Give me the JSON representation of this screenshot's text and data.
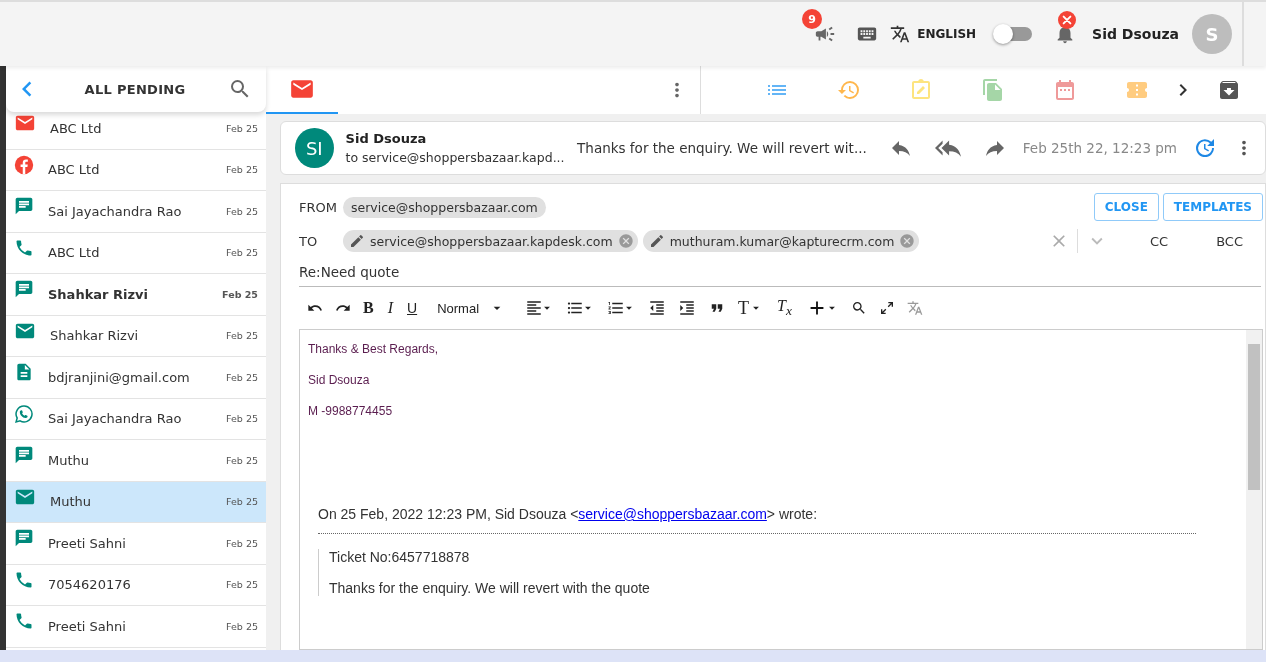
{
  "top_bar": {
    "announcement_count": "9",
    "language": "ENGLISH",
    "dark_mode_toggle": {
      "on": false
    },
    "notification_error": true,
    "user_name": "Sid Dsouza",
    "avatar_initial": "S"
  },
  "sidebar": {
    "title": "ALL PENDING",
    "items": [
      {
        "kind": "email",
        "name": "ABC Ltd",
        "date": "Feb 25",
        "unread": false,
        "selected": false,
        "color": "#f44336"
      },
      {
        "kind": "facebook",
        "name": "ABC Ltd",
        "date": "Feb 25",
        "unread": false,
        "selected": false,
        "color": "#f44336"
      },
      {
        "kind": "chat",
        "name": "Sai Jayachandra Rao",
        "date": "Feb 25",
        "unread": false,
        "selected": false,
        "color": "#00897b"
      },
      {
        "kind": "phone",
        "name": "ABC Ltd",
        "date": "Feb 25",
        "unread": false,
        "selected": false,
        "color": "#00897b"
      },
      {
        "kind": "chat",
        "name": "Shahkar Rizvi",
        "date": "Feb 25",
        "unread": true,
        "selected": false,
        "color": "#00897b"
      },
      {
        "kind": "email",
        "name": "Shahkar Rizvi",
        "date": "Feb 25",
        "unread": false,
        "selected": false,
        "color": "#00897b"
      },
      {
        "kind": "document",
        "name": "bdjranjini@gmail.com",
        "date": "Feb 25",
        "unread": false,
        "selected": false,
        "color": "#00897b"
      },
      {
        "kind": "whatsapp",
        "name": "Sai Jayachandra Rao",
        "date": "Feb 25",
        "unread": false,
        "selected": false,
        "color": "#00897b"
      },
      {
        "kind": "chat",
        "name": "Muthu",
        "date": "Feb 25",
        "unread": false,
        "selected": false,
        "color": "#00897b"
      },
      {
        "kind": "email",
        "name": "Muthu",
        "date": "Feb 25",
        "unread": false,
        "selected": true,
        "color": "#00897b"
      },
      {
        "kind": "chat",
        "name": "Preeti Sahni",
        "date": "Feb 25",
        "unread": false,
        "selected": false,
        "color": "#00897b"
      },
      {
        "kind": "phone",
        "name": "7054620176",
        "date": "Feb 25",
        "unread": false,
        "selected": false,
        "color": "#00897b"
      },
      {
        "kind": "phone",
        "name": "Preeti Sahni",
        "date": "Feb 25",
        "unread": false,
        "selected": false,
        "color": "#00897b"
      }
    ]
  },
  "conversation_tabs": [
    {
      "kind": "email",
      "selected": true
    }
  ],
  "message": {
    "avatar_initials": "SI",
    "sender": "Sid Dsouza",
    "to": "to service@shoppersbazaar.kapd...",
    "preview": "Thanks for the enquiry. We will revert wit...",
    "time": "Feb 25th 22, 12:23 pm"
  },
  "composer": {
    "from_label": "FROM",
    "from": "service@shoppersbazaar.com",
    "to_label": "TO",
    "recipients": [
      "service@shoppersbazaar.kapdesk.com",
      "muthuram.kumar@kapturecrm.com"
    ],
    "cc": "CC",
    "bcc": "BCC",
    "buttons": [
      "CLOSE",
      "TEMPLATES"
    ],
    "subject": "Re:Need quote",
    "toolbar": {
      "bold": "B",
      "italic": "I",
      "underline": "U",
      "paragraph_style": "Normal",
      "text_size": "T",
      "clear_format": "T$_{x}$"
    },
    "body": {
      "signature": [
        "Thanks & Best Regards,",
        "Sid Dsouza",
        "M -9988774455"
      ],
      "quote_intro": {
        "before": "On 25 Feb, 2022 12:23 PM, Sid Dsouza <",
        "link": "service@shoppersbazaar.com",
        "after": "> wrote:"
      },
      "quoted": [
        "Ticket No:6457718878",
        "Thanks for the enquiry. We will revert with the quote"
      ]
    }
  }
}
